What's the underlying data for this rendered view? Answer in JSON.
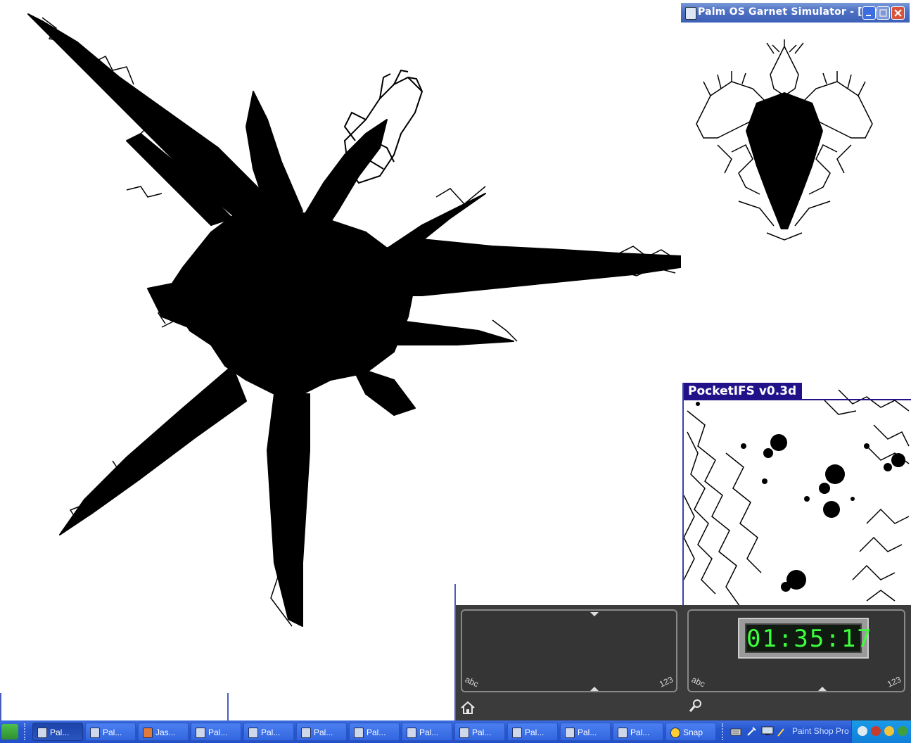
{
  "simulator": {
    "title": "Palm OS Garnet Simulator - [Simul...",
    "app_title": "PocketIFS v0.3d"
  },
  "clock": {
    "time": "01:35:17"
  },
  "graffiti": {
    "left": {
      "abc": "abc",
      "num": "123"
    },
    "right": {
      "abc": "abc",
      "num": "123"
    }
  },
  "taskbar": {
    "items": [
      {
        "label": "Pal...",
        "icon": "palm-sim-icon",
        "active": true
      },
      {
        "label": "Pal...",
        "icon": "palm-app-icon",
        "active": false
      },
      {
        "label": "Jas...",
        "icon": "jasc-icon",
        "active": false
      },
      {
        "label": "Pal...",
        "icon": "palm-sim-icon",
        "active": false
      },
      {
        "label": "Pal...",
        "icon": "palm-sim-icon",
        "active": false
      },
      {
        "label": "Pal...",
        "icon": "palm-sim-icon",
        "active": false
      },
      {
        "label": "Pal...",
        "icon": "palm-sim-icon",
        "active": false
      },
      {
        "label": "Pal...",
        "icon": "palm-sim-icon",
        "active": false
      },
      {
        "label": "Pal...",
        "icon": "palm-sim-icon",
        "active": false
      },
      {
        "label": "Pal...",
        "icon": "palm-sim-icon",
        "active": false
      },
      {
        "label": "Pal...",
        "icon": "palm-sim-icon",
        "active": false
      },
      {
        "label": "Pal...",
        "icon": "palm-sim-icon",
        "active": false
      },
      {
        "label": "Snap",
        "icon": "snap-icon",
        "active": false
      }
    ],
    "quick_launch_label": "Paint Shop Pro"
  }
}
